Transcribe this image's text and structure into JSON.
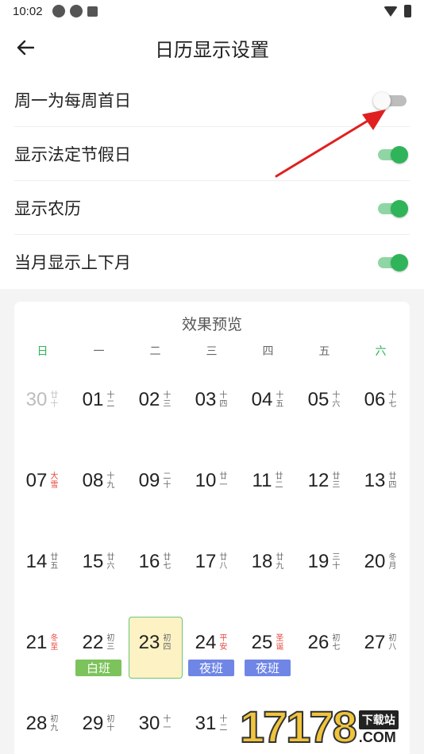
{
  "status_bar": {
    "time": "10:02",
    "icons": [
      "aperture-icon",
      "aperture-icon",
      "a-notification-icon"
    ],
    "right_icons": [
      "wifi-icon",
      "battery-icon"
    ]
  },
  "header": {
    "title": "日历显示设置",
    "back_icon": "arrow-left-icon"
  },
  "settings": [
    {
      "label": "周一为每周首日",
      "on": false
    },
    {
      "label": "显示法定节假日",
      "on": true
    },
    {
      "label": "显示农历",
      "on": true
    },
    {
      "label": "当月显示上下月",
      "on": true
    }
  ],
  "colors": {
    "accent_green": "#2fb45a",
    "holiday_red": "#e5473c",
    "work_badge": "#7cc35b",
    "night_badge": "#6f86e6",
    "today_fill": "#fdf2c4"
  },
  "preview": {
    "title": "效果预览",
    "weekdays": [
      "日",
      "一",
      "二",
      "三",
      "四",
      "五",
      "六"
    ],
    "weeks": [
      [
        {
          "day": "30",
          "lunar": "廿十",
          "dim": true
        },
        {
          "day": "01",
          "lunar": "十二"
        },
        {
          "day": "02",
          "lunar": "十三"
        },
        {
          "day": "03",
          "lunar": "十四"
        },
        {
          "day": "04",
          "lunar": "十五"
        },
        {
          "day": "05",
          "lunar": "十六"
        },
        {
          "day": "06",
          "lunar": "十七"
        }
      ],
      [
        {
          "day": "07",
          "lunar": "大雪",
          "red": true
        },
        {
          "day": "08",
          "lunar": "十九"
        },
        {
          "day": "09",
          "lunar": "二十"
        },
        {
          "day": "10",
          "lunar": "廿一"
        },
        {
          "day": "11",
          "lunar": "廿二"
        },
        {
          "day": "12",
          "lunar": "廿三"
        },
        {
          "day": "13",
          "lunar": "廿四"
        }
      ],
      [
        {
          "day": "14",
          "lunar": "廿五"
        },
        {
          "day": "15",
          "lunar": "廿六"
        },
        {
          "day": "16",
          "lunar": "廿七"
        },
        {
          "day": "17",
          "lunar": "廿八"
        },
        {
          "day": "18",
          "lunar": "廿九"
        },
        {
          "day": "19",
          "lunar": "三十"
        },
        {
          "day": "20",
          "lunar": "冬月"
        }
      ],
      [
        {
          "day": "21",
          "lunar": "冬至",
          "red": true
        },
        {
          "day": "22",
          "lunar": "初三",
          "badge": "白班",
          "badge_type": "work"
        },
        {
          "day": "23",
          "lunar": "初四",
          "today": true
        },
        {
          "day": "24",
          "lunar": "平安",
          "red": true,
          "badge": "夜班",
          "badge_type": "night"
        },
        {
          "day": "25",
          "lunar": "圣诞",
          "red": true,
          "badge": "夜班",
          "badge_type": "night"
        },
        {
          "day": "26",
          "lunar": "初七"
        },
        {
          "day": "27",
          "lunar": "初八"
        }
      ],
      [
        {
          "day": "28",
          "lunar": "初九"
        },
        {
          "day": "29",
          "lunar": "初十"
        },
        {
          "day": "30",
          "lunar": "十一"
        },
        {
          "day": "31",
          "lunar": "十二"
        },
        {
          "day": "",
          "lunar": ""
        },
        {
          "day": "",
          "lunar": ""
        },
        {
          "day": "",
          "lunar": ""
        }
      ]
    ]
  },
  "watermark": {
    "number": "17178",
    "label": "下载站",
    "domain": ".COM"
  }
}
